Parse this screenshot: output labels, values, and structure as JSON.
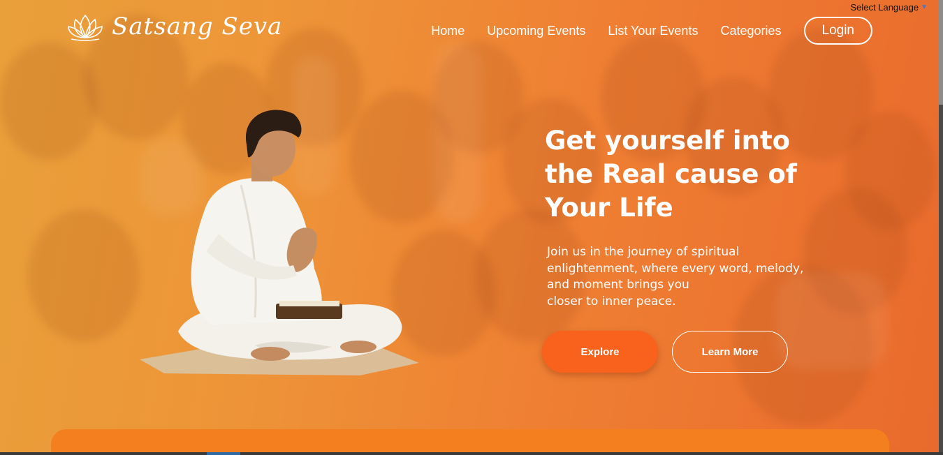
{
  "language": {
    "label": "Select Language",
    "caret_icon": "caret-down-icon"
  },
  "brand": {
    "name": "Satsang Seva",
    "logo_icon": "lotus-logo-icon"
  },
  "nav": {
    "items": [
      {
        "label": "Home"
      },
      {
        "label": "Upcoming Events"
      },
      {
        "label": "List Your Events"
      },
      {
        "label": "Categories"
      }
    ],
    "login_label": "Login"
  },
  "hero": {
    "title": "Get yourself into the Real cause of Your Life",
    "subtitle_lines": [
      "Join us in the journey of spiritual",
      "enlightenment, where every word, melody,",
      "and moment brings you",
      "closer to inner peace."
    ],
    "explore_label": "Explore",
    "learn_more_label": "Learn More",
    "image": "meditating-man-image"
  },
  "colors": {
    "accent": "#f8621d",
    "card": "#f47f1f",
    "text": "#ffffff"
  }
}
